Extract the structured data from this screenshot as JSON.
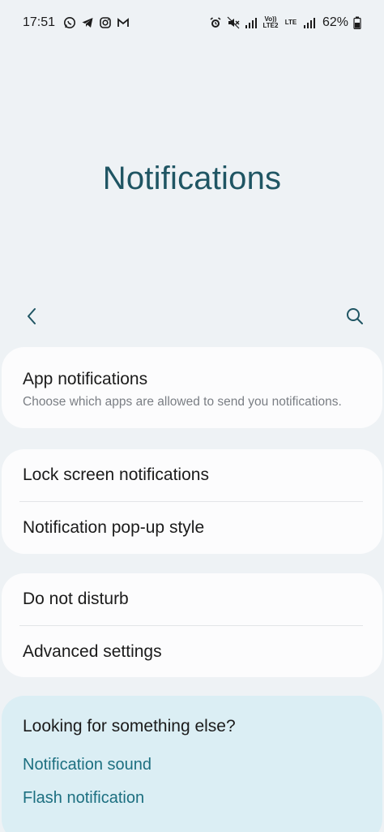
{
  "status_bar": {
    "time": "17:51",
    "left_icons": [
      "whatsapp-icon",
      "telegram-icon",
      "instagram-icon",
      "gmail-icon"
    ],
    "right_icons": [
      "alarm-icon",
      "mute-icon",
      "signal-icon",
      "volte-icon",
      "lte-icon",
      "signal-icon-2",
      "battery-icon"
    ],
    "volte_label": "Vo)) LTE2",
    "lte_label": "LTE",
    "battery": "62%"
  },
  "header": {
    "title": "Notifications"
  },
  "toolbar": {
    "back_icon": "chevron-left-icon",
    "search_icon": "search-icon"
  },
  "cards": {
    "app_notifications": {
      "title": "App notifications",
      "subtitle": "Choose which apps are allowed to send you notifications."
    },
    "lock_screen": {
      "title": "Lock screen notifications"
    },
    "popup_style": {
      "title": "Notification pop-up style"
    },
    "dnd": {
      "title": "Do not disturb"
    },
    "advanced": {
      "title": "Advanced settings"
    }
  },
  "suggestions": {
    "title": "Looking for something else?",
    "links": [
      "Notification sound",
      "Flash notification"
    ]
  },
  "colors": {
    "background": "#eef2f5",
    "title": "#1f5563",
    "link": "#1c6f80",
    "suggest_bg": "#dbeef4"
  }
}
